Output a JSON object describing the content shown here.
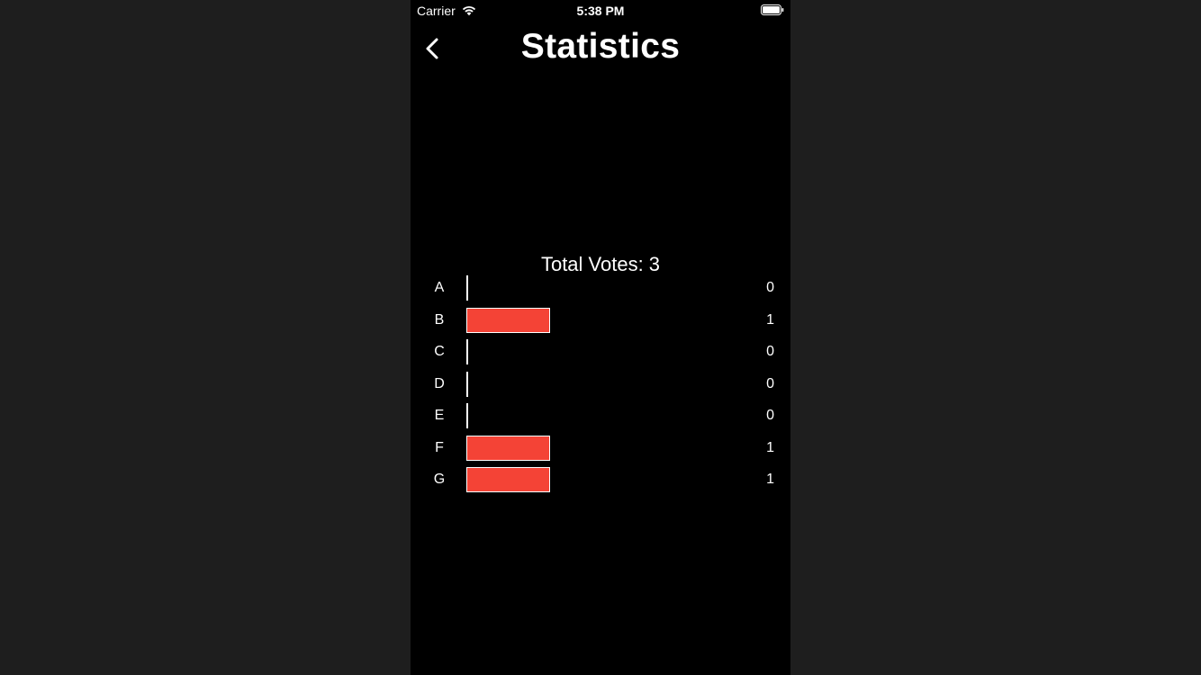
{
  "status_bar": {
    "carrier": "Carrier",
    "time": "5:38 PM"
  },
  "nav": {
    "title": "Statistics",
    "back_icon": "chevron-left-icon"
  },
  "summary": {
    "total_label": "Total Votes: 3"
  },
  "colors": {
    "bar": "#f44336",
    "background": "#000000"
  },
  "chart_data": {
    "type": "bar",
    "orientation": "horizontal",
    "categories": [
      "A",
      "B",
      "C",
      "D",
      "E",
      "F",
      "G"
    ],
    "values": [
      0,
      1,
      0,
      0,
      0,
      1,
      1
    ],
    "xlim": [
      0,
      3
    ]
  }
}
